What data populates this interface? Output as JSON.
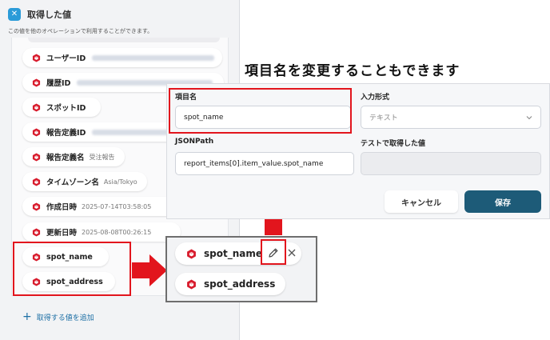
{
  "left_panel": {
    "title": "取得した値",
    "description": "この値を他のオペレーションで利用することができます。",
    "items": [
      {
        "name": "ユーザーID",
        "value": ""
      },
      {
        "name": "履歴ID",
        "value": ""
      },
      {
        "name": "スポットID",
        "value": ""
      },
      {
        "name": "報告定義ID",
        "value": ""
      },
      {
        "name": "報告定義名",
        "value": "受注報告"
      },
      {
        "name": "タイムゾーン名",
        "value": "Asia/Tokyo"
      },
      {
        "name": "作成日時",
        "value": "2025-07-14T03:58:05"
      },
      {
        "name": "更新日時",
        "value": "2025-08-08T00:26:15"
      },
      {
        "name": "spot_name",
        "value": ""
      },
      {
        "name": "spot_address",
        "value": ""
      }
    ],
    "add_label": "取得する値を追加"
  },
  "heading": "項目名を変更することもできます",
  "edit_panel": {
    "field_name_label": "項目名",
    "field_name_value": "spot_name",
    "input_type_label": "入力形式",
    "input_type_value": "テキスト",
    "jsonpath_label": "JSONPath",
    "jsonpath_value": "report_items[0].item_value.spot_name",
    "test_value_label": "テストで取得した値",
    "test_value": "",
    "cancel_label": "キャンセル",
    "save_label": "保存"
  },
  "zoom": {
    "items": [
      "spot_name",
      "spot_address"
    ]
  },
  "colors": {
    "highlight_red": "#e2151d",
    "save_button": "#1d5b78",
    "gem_red": "#d81b2c",
    "link_blue": "#1d6fa5"
  }
}
